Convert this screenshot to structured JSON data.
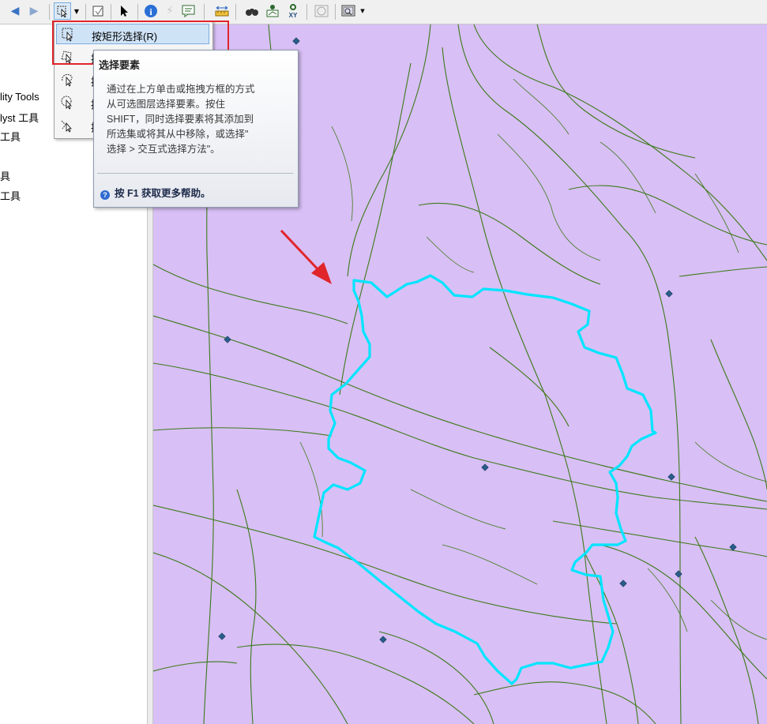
{
  "toolbar": {
    "icons": [
      "back-arrow-icon",
      "forward-arrow-icon",
      "select-features-icon",
      "dropdown-icon",
      "clear-selection-icon",
      "select-elements-icon",
      "identify-icon",
      "hyperlink-icon",
      "html-popup-icon",
      "measure-icon",
      "find-icon",
      "find-route-icon",
      "go-to-xy-icon",
      "time-slider-icon",
      "create-viewer-icon"
    ]
  },
  "left_panel": {
    "items": [
      "lity Tools",
      "lyst 工具",
      "工具",
      "具",
      "工具"
    ]
  },
  "select_menu": {
    "items": [
      {
        "label": "按矩形选择(R)",
        "icon": "select-by-rectangle-icon",
        "selected": true
      },
      {
        "label": "按",
        "icon": "select-by-polygon-icon",
        "selected": false
      },
      {
        "label": "按",
        "icon": "select-by-lasso-icon",
        "selected": false
      },
      {
        "label": "按",
        "icon": "select-by-circle-icon",
        "selected": false
      },
      {
        "label": "按",
        "icon": "select-by-line-icon",
        "selected": false
      }
    ]
  },
  "tooltip": {
    "title": "选择要素",
    "body": "通过在上方单击或拖拽方框的方式\n从可选图层选择要素。按住\nSHIFT，同时选择要素将其添加到\n所选集或将其从中移除，或选择\"\n选择 > 交互式选择方法\"。",
    "help": "按 F1 获取更多帮助。"
  },
  "colors": {
    "map_bg": "#d8bff5",
    "roads": "#3d7a1a",
    "boundary": "#00e5ff",
    "points": "#2a5c8a",
    "highlight_box": "#e0252b",
    "arrow": "#e0252b"
  }
}
